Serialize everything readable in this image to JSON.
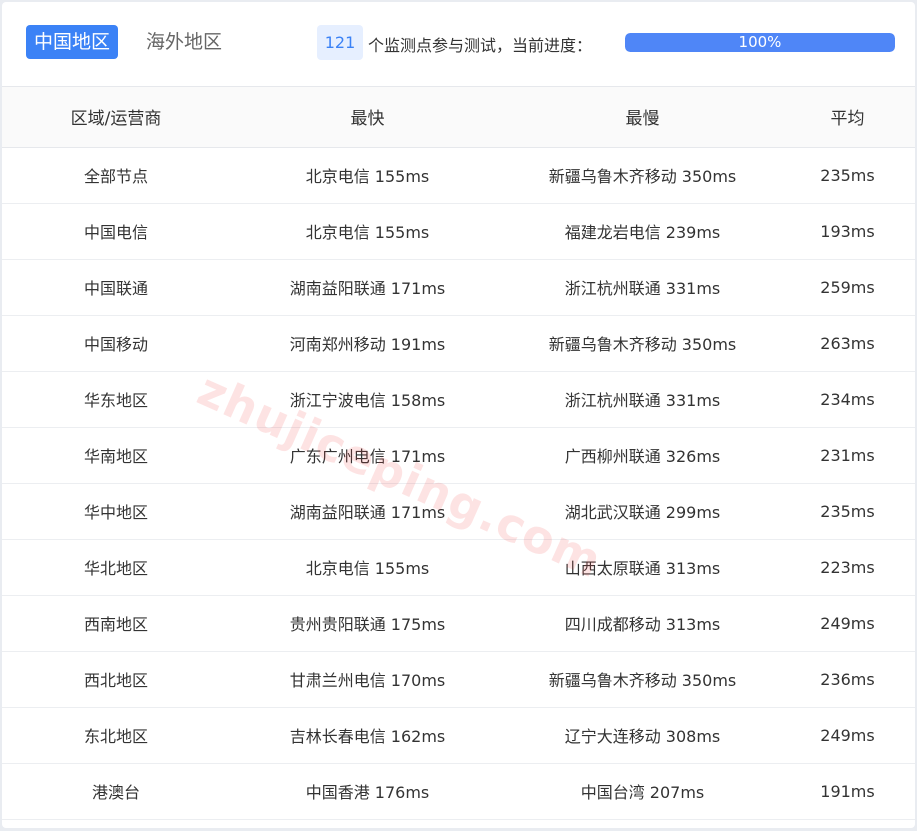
{
  "tabs": {
    "active": "中国地区",
    "inactive": "海外地区"
  },
  "progress": {
    "count": "121",
    "text": "个监测点参与测试，当前进度：",
    "label": "100%",
    "fraction": 1.0,
    "color": "#4f86f7"
  },
  "table": {
    "headers": [
      "区域/运营商",
      "最快",
      "最慢",
      "平均"
    ],
    "rows": [
      [
        "全部节点",
        "北京电信 155ms",
        "新疆乌鲁木齐移动 350ms",
        "235ms"
      ],
      [
        "中国电信",
        "北京电信 155ms",
        "福建龙岩电信 239ms",
        "193ms"
      ],
      [
        "中国联通",
        "湖南益阳联通 171ms",
        "浙江杭州联通 331ms",
        "259ms"
      ],
      [
        "中国移动",
        "河南郑州移动 191ms",
        "新疆乌鲁木齐移动 350ms",
        "263ms"
      ],
      [
        "华东地区",
        "浙江宁波电信 158ms",
        "浙江杭州联通 331ms",
        "234ms"
      ],
      [
        "华南地区",
        "广东广州电信 171ms",
        "广西柳州联通 326ms",
        "231ms"
      ],
      [
        "华中地区",
        "湖南益阳联通 171ms",
        "湖北武汉联通 299ms",
        "235ms"
      ],
      [
        "华北地区",
        "北京电信 155ms",
        "山西太原联通 313ms",
        "223ms"
      ],
      [
        "西南地区",
        "贵州贵阳联通 175ms",
        "四川成都移动 313ms",
        "249ms"
      ],
      [
        "西北地区",
        "甘肃兰州电信 170ms",
        "新疆乌鲁木齐移动 350ms",
        "236ms"
      ],
      [
        "东北地区",
        "吉林长春电信 162ms",
        "辽宁大连移动 308ms",
        "249ms"
      ],
      [
        "港澳台",
        "中国香港 176ms",
        "中国台湾 207ms",
        "191ms"
      ]
    ]
  },
  "watermark": "zhujiceping.com",
  "colors": {
    "accent": "#3b82f6",
    "badge_bg": "#e6efff",
    "header_bg": "#fafafa"
  }
}
